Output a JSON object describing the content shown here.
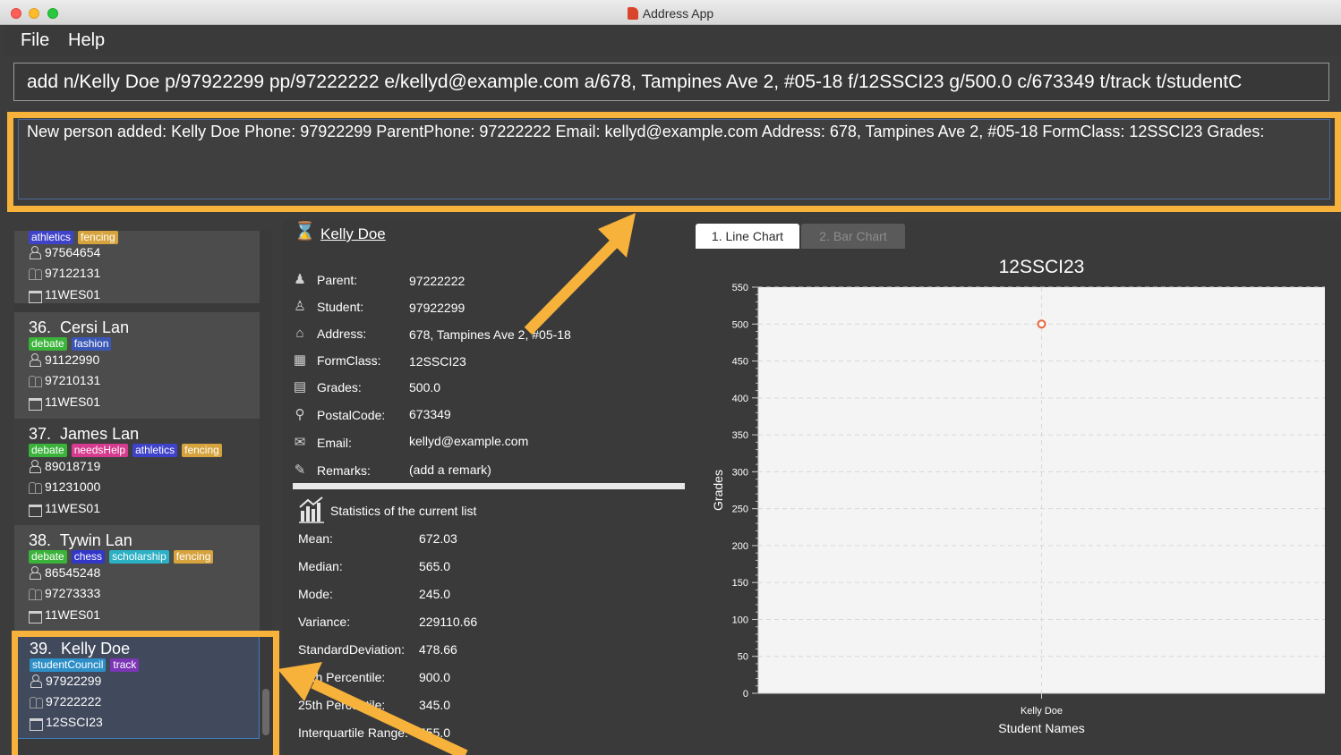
{
  "window": {
    "title": "Address App"
  },
  "menu": {
    "file": "File",
    "help": "Help"
  },
  "command": {
    "value": "add n/Kelly Doe p/97922299 pp/97222222 e/kellyd@example.com a/678, Tampines Ave 2, #05-18 f/12SSCI23 g/500.0 c/673349 t/track t/studentC"
  },
  "result": {
    "text": "New person added: Kelly Doe Phone: 97922299 ParentPhone: 97222222 Email: kellyd@example.com Address: 678, Tampines Ave 2, #05-18 FormClass: 12SSCI23 Grades:"
  },
  "persons": [
    {
      "index": "",
      "name": "",
      "tags": [
        {
          "label": "athletics",
          "color": "#3f43c9"
        },
        {
          "label": "fencing",
          "color": "#d6a33d"
        }
      ],
      "phone": "97564654",
      "parent_phone": "97122131",
      "form_class": "11WES01"
    },
    {
      "index": "36.",
      "name": "Cersi Lan",
      "tags": [
        {
          "label": "debate",
          "color": "#3bb33b"
        },
        {
          "label": "fashion",
          "color": "#3a57b6"
        }
      ],
      "phone": "91122990",
      "parent_phone": "97210131",
      "form_class": "11WES01"
    },
    {
      "index": "37.",
      "name": "James Lan",
      "tags": [
        {
          "label": "debate",
          "color": "#3bb33b"
        },
        {
          "label": "needsHelp",
          "color": "#d53b8e"
        },
        {
          "label": "athletics",
          "color": "#3f43c9"
        },
        {
          "label": "fencing",
          "color": "#d6a33d"
        }
      ],
      "phone": "89018719",
      "parent_phone": "91231000",
      "form_class": "11WES01"
    },
    {
      "index": "38.",
      "name": "Tywin Lan",
      "tags": [
        {
          "label": "debate",
          "color": "#3bb33b"
        },
        {
          "label": "chess",
          "color": "#3237c8"
        },
        {
          "label": "scholarship",
          "color": "#2bb0c4"
        },
        {
          "label": "fencing",
          "color": "#d6a33d"
        }
      ],
      "phone": "86545248",
      "parent_phone": "97273333",
      "form_class": "11WES01"
    },
    {
      "index": "39.",
      "name": "Kelly Doe",
      "tags": [
        {
          "label": "studentCouncil",
          "color": "#2d8fc8"
        },
        {
          "label": "track",
          "color": "#7b35b5"
        }
      ],
      "phone": "97922299",
      "parent_phone": "97222222",
      "form_class": "12SSCI23"
    }
  ],
  "detail": {
    "name": "Kelly Doe",
    "parent_label": "Parent:",
    "parent_value": "97222222",
    "student_label": "Student:",
    "student_value": "97922299",
    "address_label": "Address:",
    "address_value": "678, Tampines Ave 2, #05-18",
    "formclass_label": "FormClass:",
    "formclass_value": "12SSCI23",
    "grades_label": "Grades:",
    "grades_value": "500.0",
    "postal_label": "PostalCode:",
    "postal_value": "673349",
    "email_label": "Email:",
    "email_value": "kellyd@example.com",
    "remarks_label": "Remarks:",
    "remarks_value": "(add a remark)"
  },
  "stats": {
    "title": "Statistics of the current list",
    "mean_label": "Mean:",
    "mean_value": "672.03",
    "median_label": "Median:",
    "median_value": "565.0",
    "mode_label": "Mode:",
    "mode_value": "245.0",
    "variance_label": "Variance:",
    "variance_value": "229110.66",
    "sd_label": "StandardDeviation:",
    "sd_value": "478.66",
    "p75_label": "75th Percentile:",
    "p75_value": "900.0",
    "p25_label": "25th Percentile:",
    "p25_value": "345.0",
    "iqr_label": "Interquartile Range:",
    "iqr_value": "555.0"
  },
  "chart_tabs": {
    "line": "1. Line Chart",
    "bar": "2. Bar Chart"
  },
  "colors": {
    "highlight": "#f7b23b",
    "point": "#e8643a"
  },
  "chart_data": {
    "type": "line",
    "title": "12SSCI23",
    "xlabel": "Student Names",
    "ylabel": "Grades",
    "categories": [
      "Kelly Doe"
    ],
    "series": [
      {
        "values": [
          500
        ]
      }
    ],
    "ylim": [
      0,
      550
    ],
    "yticks": [
      0,
      50,
      100,
      150,
      200,
      250,
      300,
      350,
      400,
      450,
      500,
      550
    ],
    "grid": true
  }
}
